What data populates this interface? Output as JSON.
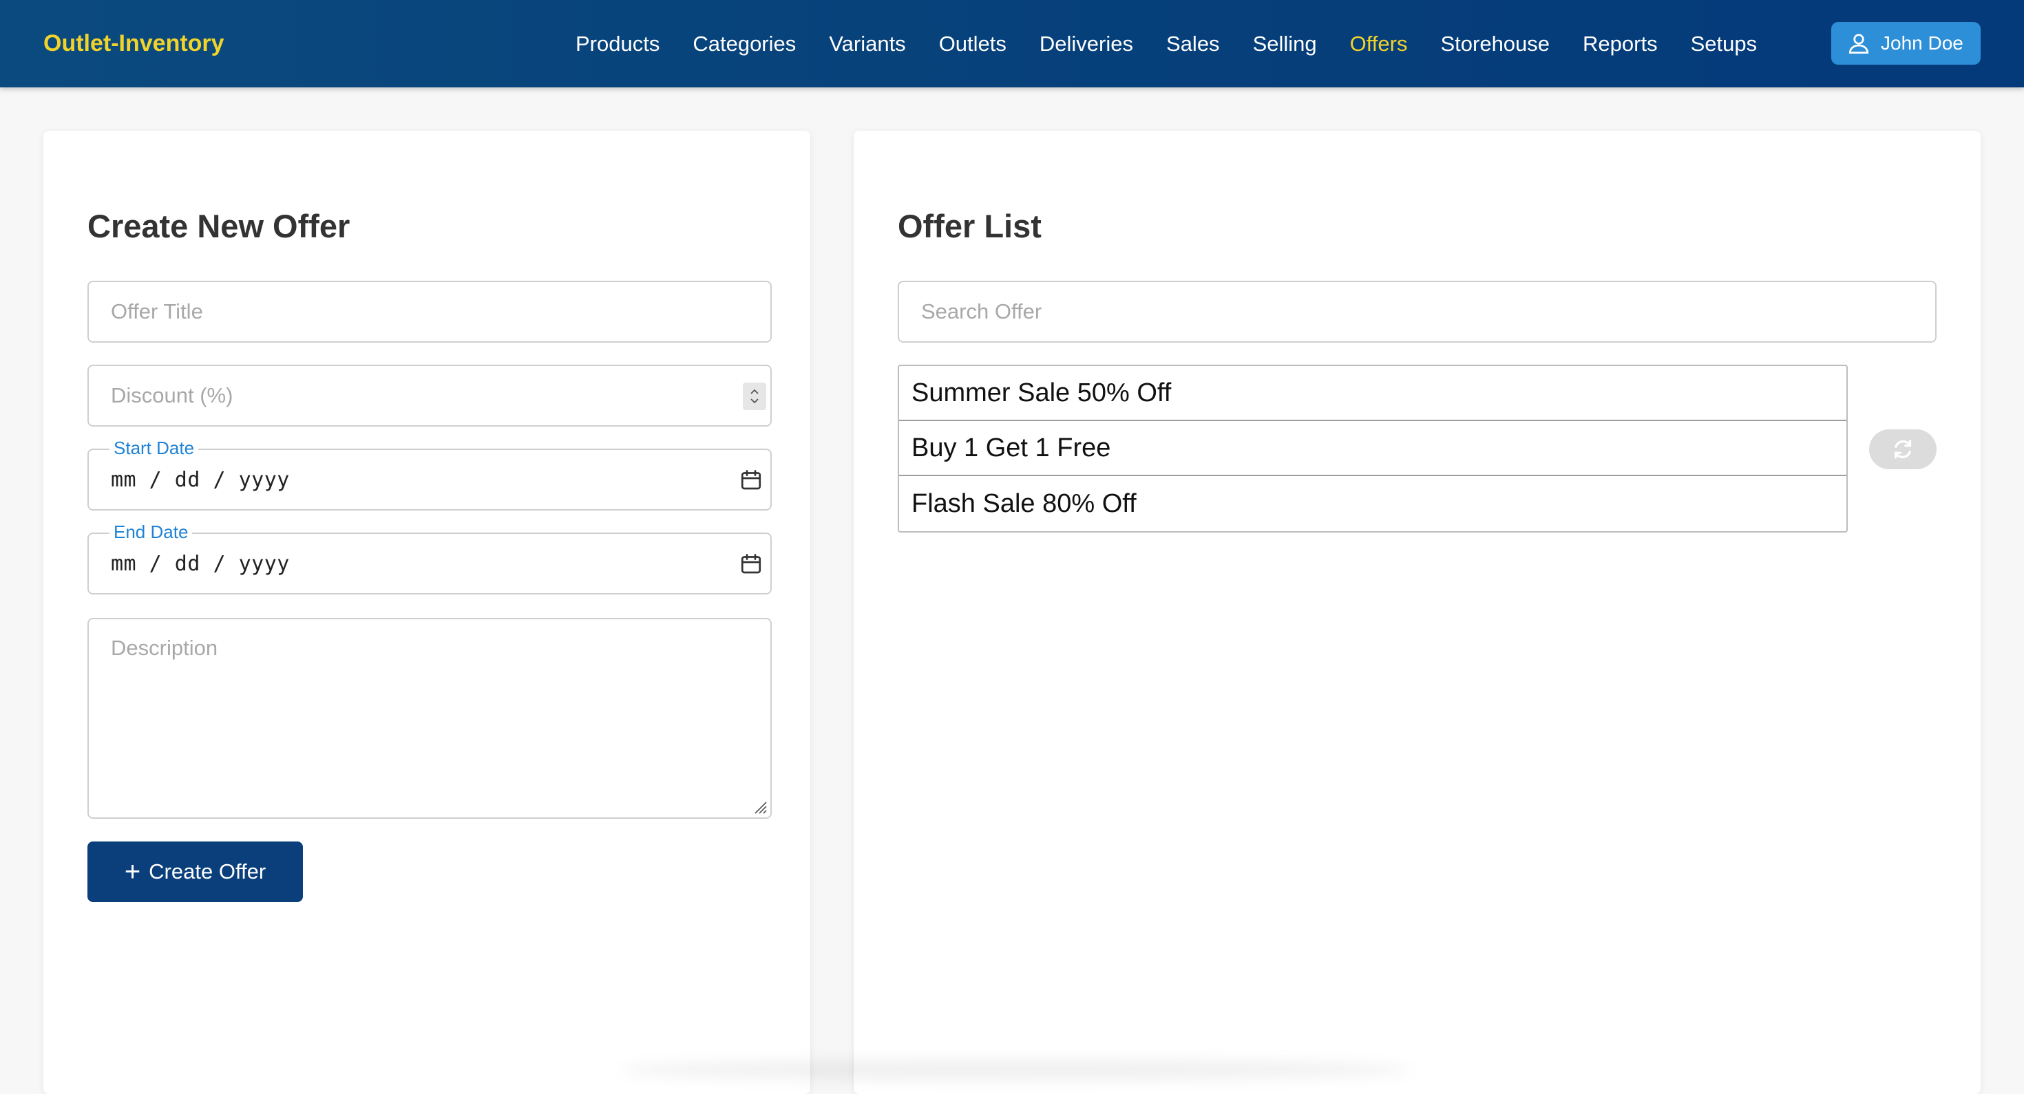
{
  "app": {
    "brand": "Outlet-Inventory"
  },
  "nav": {
    "items": [
      {
        "label": "Products"
      },
      {
        "label": "Categories"
      },
      {
        "label": "Variants"
      },
      {
        "label": "Outlets"
      },
      {
        "label": "Deliveries"
      },
      {
        "label": "Sales"
      },
      {
        "label": "Selling"
      },
      {
        "label": "Offers",
        "active": true
      },
      {
        "label": "Storehouse"
      },
      {
        "label": "Reports"
      },
      {
        "label": "Setups"
      }
    ],
    "user": {
      "name": "John Doe",
      "icon": "user-icon"
    }
  },
  "create_form": {
    "title": "Create New Offer",
    "offer_title_placeholder": "Offer Title",
    "discount_placeholder": "Discount (%)",
    "start_date_label": "Start Date",
    "start_date_value": "mm / dd / yyyy",
    "end_date_label": "End Date",
    "end_date_value": "mm / dd / yyyy",
    "description_placeholder": "Description",
    "submit_label": "Create Offer",
    "submit_icon": "plus-icon"
  },
  "offer_list": {
    "title": "Offer List",
    "search_placeholder": "Search Offer",
    "items": [
      {
        "label": "Summer Sale 50% Off"
      },
      {
        "label": "Buy 1 Get 1 Free"
      },
      {
        "label": "Flash Sale 80% Off"
      }
    ],
    "refresh_icon": "refresh-icon"
  },
  "colors": {
    "navbar": "#063f7a",
    "brand": "#f2d32a",
    "active_nav": "#f2d32a",
    "user_button": "#2d8fd8",
    "primary_button": "#0a3f7b",
    "floating_label": "#1e82d6"
  }
}
